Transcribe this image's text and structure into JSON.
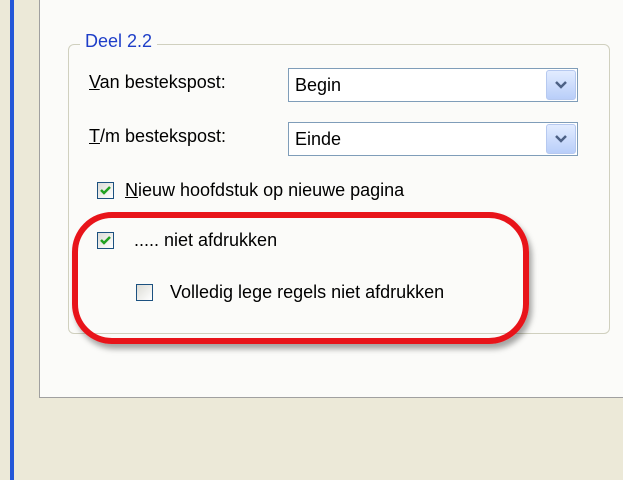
{
  "group": {
    "title": "Deel 2.2"
  },
  "fields": {
    "from": {
      "label_access_key": "V",
      "label_rest": "an bestekspost:",
      "value": "Begin"
    },
    "to": {
      "label_access_key": "T",
      "label_rest": "/m bestekspost:",
      "value": "Einde"
    }
  },
  "checkboxes": {
    "new_chapter": {
      "label_access_key": "N",
      "label_rest": "ieuw hoofdstuk op nieuwe pagina",
      "checked": true
    },
    "dont_print": {
      "label": "..... niet afdrukken",
      "checked": true
    },
    "empty_lines": {
      "label": "Volledig lege regels niet afdrukken",
      "checked": false
    }
  },
  "colors": {
    "highlight": "#e8141a",
    "group_title": "#1e3ec8",
    "check_mark": "#21a121"
  },
  "icons": [
    "chevron-down-icon",
    "checkmark-icon"
  ]
}
